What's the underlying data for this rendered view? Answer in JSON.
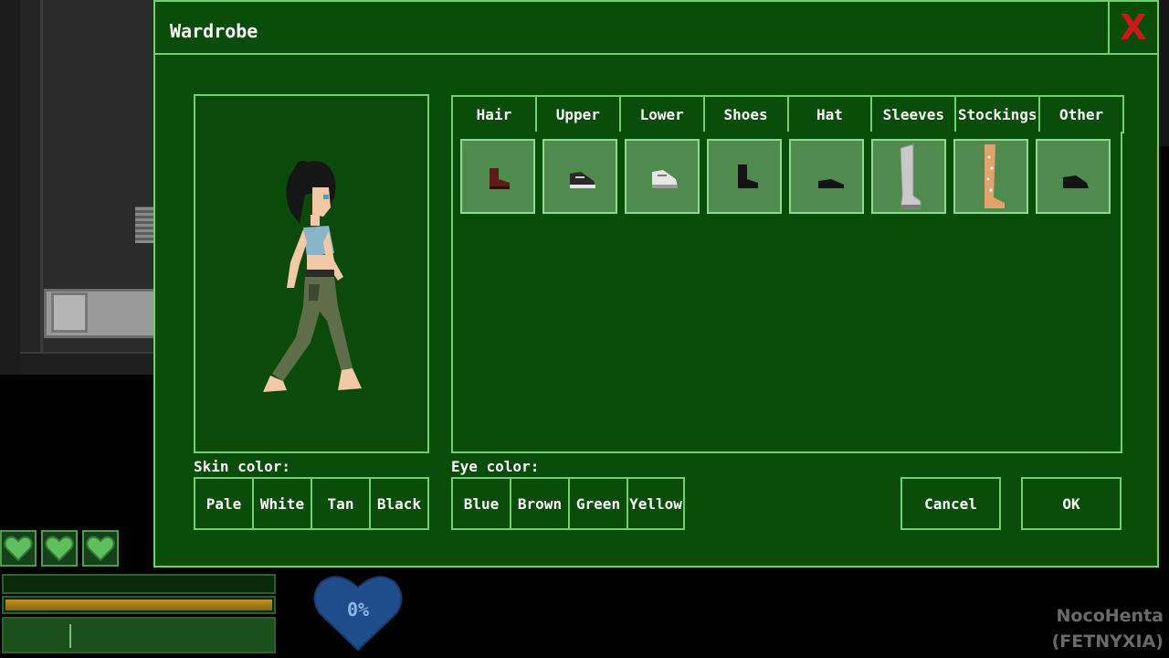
{
  "window": {
    "title": "Wardrobe",
    "close_label": "X"
  },
  "tabs": [
    {
      "label": "Hair"
    },
    {
      "label": "Upper"
    },
    {
      "label": "Lower"
    },
    {
      "label": "Shoes"
    },
    {
      "label": "Hat"
    },
    {
      "label": "Sleeves"
    },
    {
      "label": "Stockings"
    },
    {
      "label": "Other"
    }
  ],
  "items": [
    {
      "icon": "brown-boot-icon",
      "color": "#5a1e14"
    },
    {
      "icon": "dark-sneaker-icon",
      "color": "#2a2a2a"
    },
    {
      "icon": "white-sneaker-icon",
      "color": "#e6e6e6"
    },
    {
      "icon": "black-boot-icon",
      "color": "#141414"
    },
    {
      "icon": "black-flat-shoe-icon",
      "color": "#141414"
    },
    {
      "icon": "thigh-high-boot-icon",
      "color": "#c9c9c9"
    },
    {
      "icon": "patterned-stocking-icon",
      "color": "#e0a46a"
    },
    {
      "icon": "black-loafer-icon",
      "color": "#141414"
    }
  ],
  "skin": {
    "label": "Skin color:",
    "options": [
      "Pale",
      "White",
      "Tan",
      "Black"
    ]
  },
  "eye": {
    "label": "Eye color:",
    "options": [
      "Blue",
      "Brown",
      "Green",
      "Yellow"
    ]
  },
  "actions": {
    "cancel": "Cancel",
    "ok": "OK"
  },
  "hud": {
    "hearts": 3,
    "lust_percent": "0%",
    "lust_color": "#1f4d8c",
    "watermark_line1": "NocoHenta",
    "watermark_line2": "(FETNYXIA)"
  },
  "colors": {
    "panel_bg": "#0a4d0a",
    "panel_border": "#6fd26f",
    "close": "#d01818"
  }
}
